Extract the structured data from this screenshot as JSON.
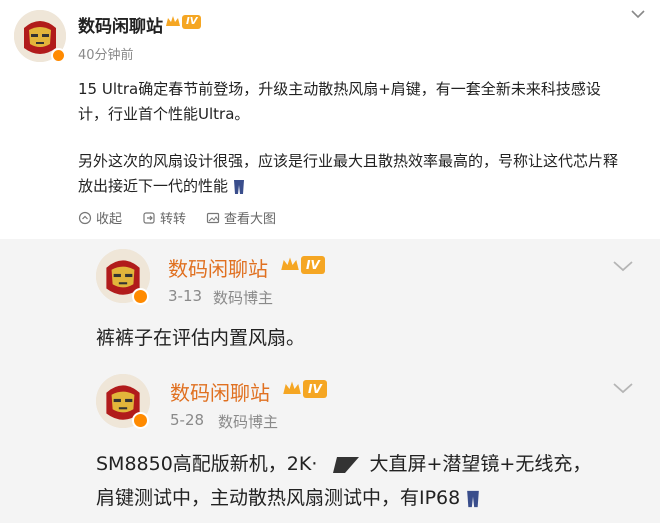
{
  "main_post": {
    "author": "数码闲聊站",
    "level": "IV",
    "time": "40分钟前",
    "line1": "15 Ultra确定春节前登场，升级主动散热风扇+肩键，有一套全新未来科技感设",
    "line2": "计，行业首个性能Ultra。",
    "line3": "另外这次的风扇设计很强，应该是行业最大且散热效率最高的，号称让这代芯片释",
    "line4": "放出接近下一代的性能",
    "actions": {
      "collect": "收起",
      "repost": "转转",
      "view_image": "查看大图"
    }
  },
  "ref1": {
    "author": "数码闲聊站",
    "level": "IV",
    "date": "3-13",
    "role": "数码博主",
    "text": "裤裤子在评估内置风扇。"
  },
  "ref2": {
    "author": "数码闲聊站",
    "level": "IV",
    "date": "5-28",
    "role": "数码博主",
    "line1a": "SM8850高配版新机，2K·",
    "line1b": "大直屏+潜望镜+无线充，",
    "line2": "肩键测试中，主动散热风扇测试中，有IP68"
  },
  "colors": {
    "accent": "#ff8a00",
    "level_badge": "#f5a623",
    "meta": "#8a8a8a"
  }
}
